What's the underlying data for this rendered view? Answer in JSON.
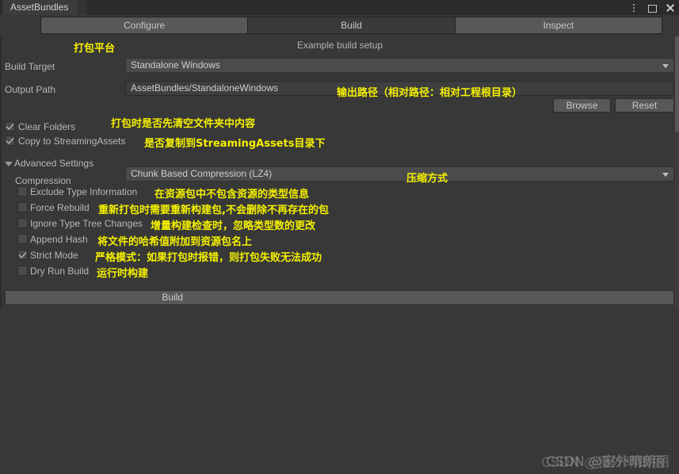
{
  "window": {
    "tab_title": "AssetBundles",
    "controls": {
      "menu_label": "⋮",
      "maximize_label": "",
      "close_label": ""
    }
  },
  "toolbar": {
    "tabs": [
      {
        "label": "Configure",
        "active": false
      },
      {
        "label": "Build",
        "active": true
      },
      {
        "label": "Inspect",
        "active": false
      }
    ]
  },
  "main": {
    "heading": "Example build setup",
    "annotations": {
      "build_target": "打包平台",
      "output_path": "输出路径（相对路径：相对工程根目录）",
      "clear_folders": "打包时是否先清空文件夹中内容",
      "copy_to_streaming": "是否复制到StreamingAssets目录下",
      "compression": "压缩方式",
      "exclude_type_info": "在资源包中不包含资源的类型信息",
      "force_rebuild": "重新打包时需要重新构建包,不会删除不再存在的包",
      "ignore_type_tree": "增量构建检查时，忽略类型数的更改",
      "append_hash": "将文件的哈希值附加到资源包名上",
      "strict_mode": "严格模式：如果打包时报错，则打包失败无法成功",
      "dry_run_build": "运行时构建"
    },
    "fields": {
      "build_target_label": "Build Target",
      "build_target_value": "Standalone Windows",
      "output_path_label": "Output Path",
      "output_path_value": "AssetBundles/StandaloneWindows"
    },
    "buttons": {
      "browse": "Browse",
      "reset": "Reset",
      "build": "Build"
    },
    "toggles": [
      {
        "label": "Clear Folders",
        "checked": true
      },
      {
        "label": "Copy to StreamingAssets",
        "checked": true
      }
    ],
    "advanced": {
      "foldout_label": "Advanced Settings",
      "expanded": true,
      "compression_label": "Compression",
      "compression_value": "Chunk Based Compression (LZ4)",
      "toggles": [
        {
          "label": "Exclude Type Information",
          "checked": false
        },
        {
          "label": "Force Rebuild",
          "checked": false
        },
        {
          "label": "Ignore Type Tree Changes",
          "checked": false
        },
        {
          "label": "Append Hash",
          "checked": false
        },
        {
          "label": "Strict Mode",
          "checked": true
        },
        {
          "label": "Dry Run Build",
          "checked": false
        }
      ]
    }
  },
  "watermark": {
    "text": "CSDN @窗外晴朗丽"
  },
  "colors": {
    "window_bg": "#383838",
    "titlebar_bg": "#2b2b2b",
    "tab_active_bg": "#3a3a3a",
    "tab_inactive_bg": "#585858",
    "annotation_yellow": "#f5f000",
    "text": "#b8b8b8"
  }
}
